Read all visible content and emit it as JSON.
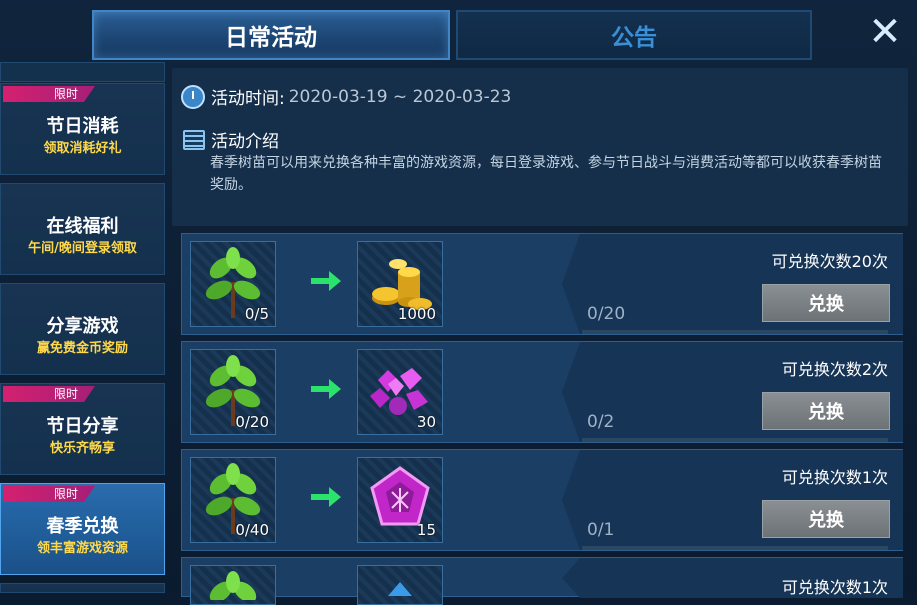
{
  "tabs": {
    "daily": "日常活动",
    "notice": "公告"
  },
  "close_icon": "close-icon",
  "sidebar": {
    "items": [
      {
        "badge": "限时",
        "title": "节日消耗",
        "subtitle": "领取消耗好礼"
      },
      {
        "badge": "",
        "title": "在线福利",
        "subtitle": "午间/晚间登录领取"
      },
      {
        "badge": "",
        "title": "分享游戏",
        "subtitle": "赢免费金币奖励"
      },
      {
        "badge": "限时",
        "title": "节日分享",
        "subtitle": "快乐齐畅享"
      },
      {
        "badge": "限时",
        "title": "春季兑换",
        "subtitle": "领丰富游戏资源",
        "active": true
      }
    ]
  },
  "info": {
    "time_label": "活动时间:",
    "time_value": "2020-03-19 ~ 2020-03-23",
    "intro_label": "活动介绍",
    "intro_text": "春季树苗可以用来兑换各种丰富的游戏资源，每日登录游戏、参与节日战斗与消费活动等都可以收获春季树苗奖励。"
  },
  "rewards": [
    {
      "cost": "0/5",
      "reward_icon": "gold-coins-icon",
      "reward_count": "1000",
      "progress": "0/20",
      "limit": "可兑换次数20次",
      "button": "兑换"
    },
    {
      "cost": "0/20",
      "reward_icon": "purple-gems-icon",
      "reward_count": "30",
      "progress": "0/2",
      "limit": "可兑换次数2次",
      "button": "兑换"
    },
    {
      "cost": "0/40",
      "reward_icon": "pentagon-gem-icon",
      "reward_count": "15",
      "progress": "0/1",
      "limit": "可兑换次数1次",
      "button": "兑换"
    },
    {
      "cost": "",
      "reward_icon": "blue-gem-icon",
      "reward_count": "",
      "progress": "",
      "limit": "可兑换次数1次",
      "button": ""
    }
  ],
  "colors": {
    "accent": "#3f86c9",
    "badge": "#d4216f",
    "subtitle": "#ffd94a",
    "arrow": "#2be36b"
  }
}
